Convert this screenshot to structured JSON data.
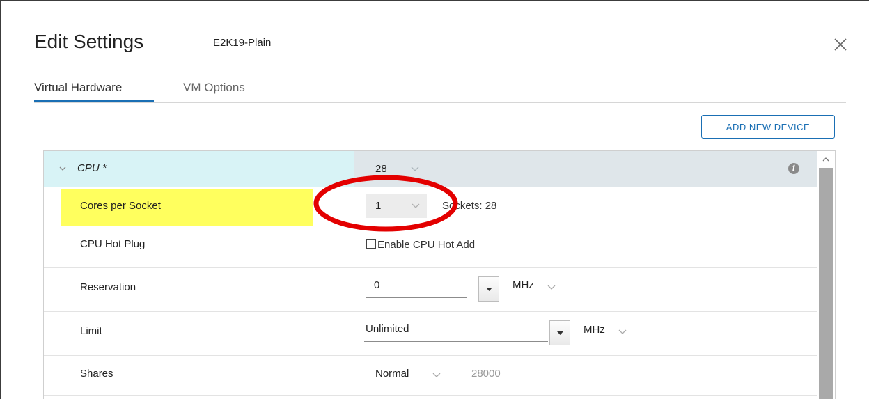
{
  "dialog": {
    "title": "Edit Settings",
    "vm_name": "E2K19-Plain"
  },
  "tabs": [
    {
      "label": "Virtual Hardware",
      "active": true
    },
    {
      "label": "VM Options",
      "active": false
    }
  ],
  "toolbar": {
    "add_device_label": "ADD NEW DEVICE"
  },
  "cpu": {
    "label": "CPU *",
    "value": "28",
    "cores_per_socket": {
      "label": "Cores per Socket",
      "value": "1",
      "sockets_text": "Sockets: 28",
      "highlighted": true
    },
    "hot_plug": {
      "label": "CPU Hot Plug",
      "checkbox_label": "Enable CPU Hot Add",
      "checked": false
    },
    "reservation": {
      "label": "Reservation",
      "value": "0",
      "unit": "MHz"
    },
    "limit": {
      "label": "Limit",
      "value": "Unlimited",
      "unit": "MHz"
    },
    "shares": {
      "label": "Shares",
      "level": "Normal",
      "value": "28000"
    }
  },
  "colors": {
    "accent": "#1a6fb4",
    "highlight": "#ffff5e",
    "annotation": "#e30000",
    "cpu_row_bg": "#d8f3f6"
  },
  "icons": {
    "close": "close-icon",
    "expand": "chevron-down-icon",
    "info": "info-icon",
    "scroll_up": "chevron-up-icon"
  }
}
